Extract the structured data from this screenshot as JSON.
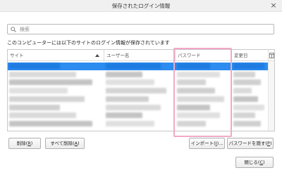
{
  "window": {
    "title": "保存されたログイン情報",
    "close_glyph": "×"
  },
  "search": {
    "placeholder": "検索",
    "value": ""
  },
  "description": "このコンピューターには以下のサイトのログイン情報が保存されています",
  "table": {
    "columns": {
      "site": "サイト",
      "username": "ユーザー名",
      "password": "パスワード",
      "modified": "変更日"
    },
    "sort_column": "site",
    "selected_row": 0,
    "row_count": 8,
    "rows_obscured": true
  },
  "buttons": {
    "remove": {
      "label": "削除(",
      "key": "R",
      "suffix": ")"
    },
    "remove_all": {
      "label": "すべて削除(",
      "key": "A",
      "suffix": ")"
    },
    "import": {
      "label": "インポート(",
      "key": "I",
      "suffix": ")..."
    },
    "hide_passwords": {
      "label": "パスワードを隠す(",
      "key": "P",
      "suffix": ")"
    },
    "close": {
      "label": "閉じる(",
      "key": "C",
      "suffix": ")"
    }
  },
  "colors": {
    "selection": "#2c8cf0",
    "highlight_box": "#f2a8c6"
  }
}
